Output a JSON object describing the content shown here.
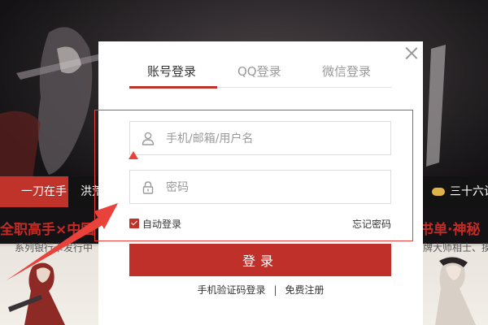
{
  "background": {
    "tabs": [
      "一刀在手",
      "洪荒",
      "三十六计"
    ],
    "promo_left": {
      "title": "全职高手×中国",
      "subtitle": "系列银行卡发行中"
    },
    "promo_right": {
      "title": "书单·神秘",
      "subtitle": "牌大师相士、摸金"
    }
  },
  "modal": {
    "tabs": [
      "账号登录",
      "QQ登录",
      "微信登录"
    ],
    "active_tab": 0,
    "username": {
      "placeholder": "手机/邮箱/用户名",
      "value": ""
    },
    "password": {
      "placeholder": "密码",
      "value": ""
    },
    "auto_login": {
      "label": "自动登录",
      "checked": true
    },
    "forgot_label": "忘记密码",
    "login_label": "登录",
    "alt_links": {
      "sms_login": "手机验证码登录",
      "separator": "|",
      "register": "免费注册"
    }
  },
  "colors": {
    "accent": "#c0302a",
    "annotation": "#e8423a"
  },
  "icons": [
    "close-icon",
    "user-icon",
    "lock-icon",
    "checkbox-checked-icon",
    "gamepad-icon"
  ]
}
